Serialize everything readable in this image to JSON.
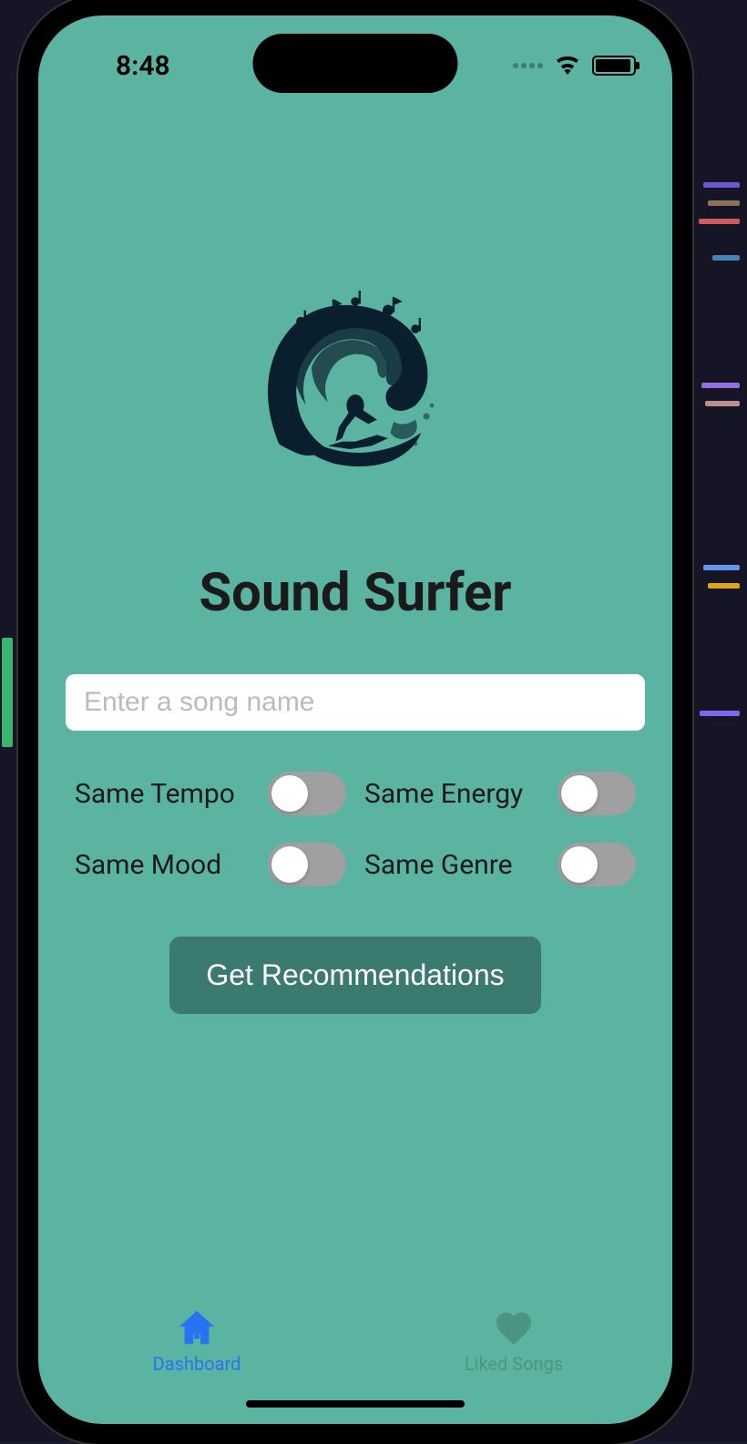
{
  "status": {
    "time": "8:48"
  },
  "app": {
    "title": "Sound Surfer"
  },
  "search": {
    "placeholder": "Enter a song name",
    "value": ""
  },
  "toggles": {
    "tempo": {
      "label": "Same Tempo",
      "on": false
    },
    "energy": {
      "label": "Same Energy",
      "on": false
    },
    "mood": {
      "label": "Same Mood",
      "on": false
    },
    "genre": {
      "label": "Same Genre",
      "on": false
    }
  },
  "actions": {
    "recommend": "Get Recommendations"
  },
  "tabs": {
    "dashboard": {
      "label": "Dashboard",
      "active": true
    },
    "liked": {
      "label": "Liked Songs",
      "active": false
    }
  },
  "colors": {
    "background": "#5BB4A1",
    "button": "#3A7A71",
    "accent": "#2874F0"
  }
}
